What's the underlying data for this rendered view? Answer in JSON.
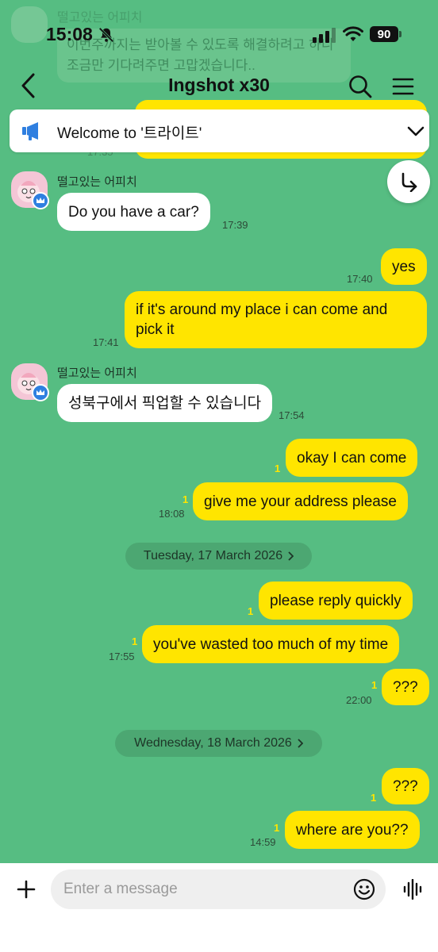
{
  "colors": {
    "chat_background": "#56bd82",
    "incoming_bubble": "#ffffff",
    "outgoing_bubble": "#ffe500",
    "unread_count": "#ffe500",
    "badge": "#2f7fe0"
  },
  "status_bar": {
    "time": "15:08",
    "battery": "90",
    "icons": [
      "bell-slash-icon",
      "cellular-signal-icon",
      "wifi-icon",
      "battery-icon"
    ]
  },
  "background_preview": {
    "sender": "떨고있는 어피치",
    "text": "이번주까지는 받아볼 수 있도록 해결하려고 하니 조금만 기다려주면 고맙겠습니다..",
    "time": "17:35"
  },
  "header": {
    "title": "Ingshot x30",
    "icons": [
      "back-chevron-icon",
      "search-icon",
      "menu-icon"
    ]
  },
  "notice": {
    "text": "Welcome to '트라이트'",
    "icons": [
      "megaphone-icon",
      "chevron-down-icon"
    ]
  },
  "scroll_button": {
    "icon": "reply-arrow-icon"
  },
  "dates": {
    "tue": "Tuesday, 17 March 2026",
    "wed": "Wednesday, 18 March 2026"
  },
  "messages": [
    {
      "dir": "in",
      "sender": "떨고있는 어피치",
      "text": "Do you have a car?",
      "time": "17:39"
    },
    {
      "dir": "out",
      "text": "yes",
      "time": "17:40",
      "unread": ""
    },
    {
      "dir": "out",
      "text": "if it's around my place i can come and pick it",
      "time": "17:41",
      "unread": ""
    },
    {
      "dir": "in",
      "sender": "떨고있는 어피치",
      "text": "성북구에서 픽업할 수 있습니다",
      "time": "17:54"
    },
    {
      "dir": "out",
      "text": "okay I can come",
      "time": "",
      "unread": "1"
    },
    {
      "dir": "out",
      "text": "give me your address please",
      "time": "18:08",
      "unread": "1"
    },
    {
      "dir": "out",
      "text": "please reply quickly",
      "time": "",
      "unread": "1"
    },
    {
      "dir": "out",
      "text": "you've wasted too much of my time",
      "time": "17:55",
      "unread": "1"
    },
    {
      "dir": "out",
      "text": "???",
      "time": "22:00",
      "unread": "1"
    },
    {
      "dir": "out",
      "text": "???",
      "time": "",
      "unread": "1"
    },
    {
      "dir": "out",
      "text": "where are you??",
      "time": "14:59",
      "unread": "1"
    }
  ],
  "composer": {
    "placeholder": "Enter a message",
    "icons": [
      "plus-icon",
      "emoji-icon",
      "voice-wave-icon"
    ]
  }
}
